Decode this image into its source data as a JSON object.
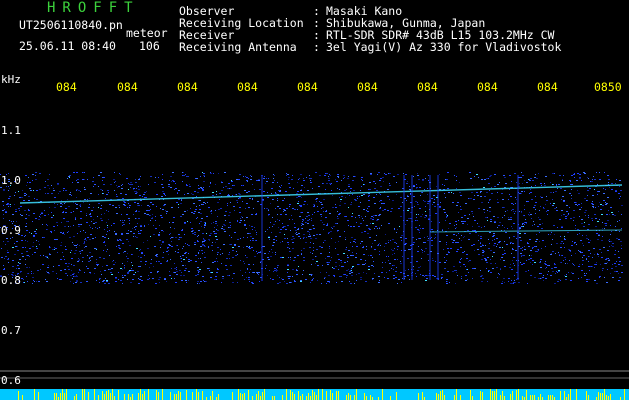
{
  "header": {
    "logo": "HROFFT",
    "filename": "UT2506110840.pn",
    "meteor_label": "meteor",
    "date_time": "25.06.11 08:40",
    "count": "106",
    "meta": [
      {
        "label": "Observer",
        "value": "Masaki Kano"
      },
      {
        "label": "Receiving Location",
        "value": "Shibukawa, Gunma, Japan"
      },
      {
        "label": "Receiver",
        "value": "RTL-SDR SDR# 43dB L15 103.2MHz CW"
      },
      {
        "label": "Receiving Antenna",
        "value": "3el Yagi(V) Az 330 for Vladivostok"
      }
    ]
  },
  "time_axis": {
    "ticks": [
      "084",
      "084",
      "084",
      "084",
      "084",
      "084",
      "084",
      "084",
      "084",
      "0850"
    ]
  },
  "freq_axis": {
    "unit": "kHz",
    "ticks": [
      "1.1",
      "1.0",
      "0.9",
      "0.8",
      "0.7",
      "0.6"
    ]
  },
  "colors": {
    "background": "#000000",
    "text_white": "#ffffff",
    "text_yellow": "#ffff00",
    "logo_green": "#3cd23c",
    "signal_blue": "#2040ff",
    "signal_cyan": "#40e0ff",
    "bottom_band": "#00c8ff"
  }
}
